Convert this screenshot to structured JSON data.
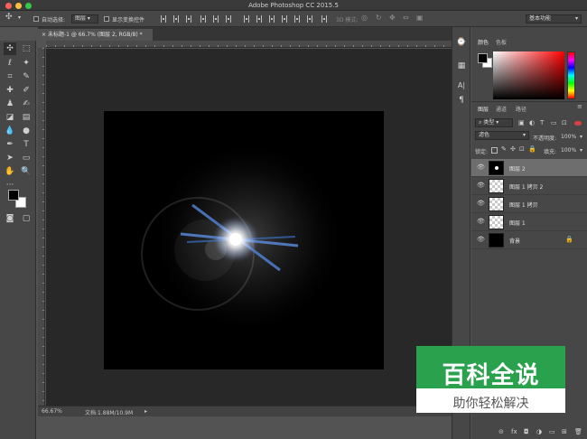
{
  "window": {
    "title": "Adobe Photoshop CC 2015.5",
    "traffic_colors": [
      "#fc605c",
      "#fdbc40",
      "#34c84a"
    ]
  },
  "options_bar": {
    "auto_select_label": "自动选择:",
    "auto_select_value": "图层",
    "show_transform_label": "显示变换控件",
    "mode_3d_label": "3D 模式:",
    "workspace_value": "基本功能"
  },
  "document": {
    "tab_label": "未标题-1 @ 66.7% (图层 2, RGB/8) *",
    "zoom": "66.67%",
    "doc_info": "文档:1.88M/10.9M"
  },
  "panels": {
    "color_tab": "颜色",
    "swatches_tab": "色板",
    "layers_tab": "图层",
    "channels_tab": "通道",
    "paths_tab": "路径",
    "filter_kind": "类型",
    "blend_mode": "滤色",
    "opacity_label": "不透明度:",
    "opacity_value": "100%",
    "lock_label": "锁定:",
    "fill_label": "填充:",
    "fill_value": "100%",
    "layers": [
      {
        "name": "图层 2",
        "selected": true
      },
      {
        "name": "图层 1 拷贝 2",
        "selected": false
      },
      {
        "name": "图层 1 拷贝",
        "selected": false
      },
      {
        "name": "图层 1",
        "selected": false
      },
      {
        "name": "背景",
        "selected": false
      }
    ]
  },
  "watermark": {
    "title": "百科全说",
    "subtitle": "助你轻松解决",
    "color": "#2aa14c"
  }
}
